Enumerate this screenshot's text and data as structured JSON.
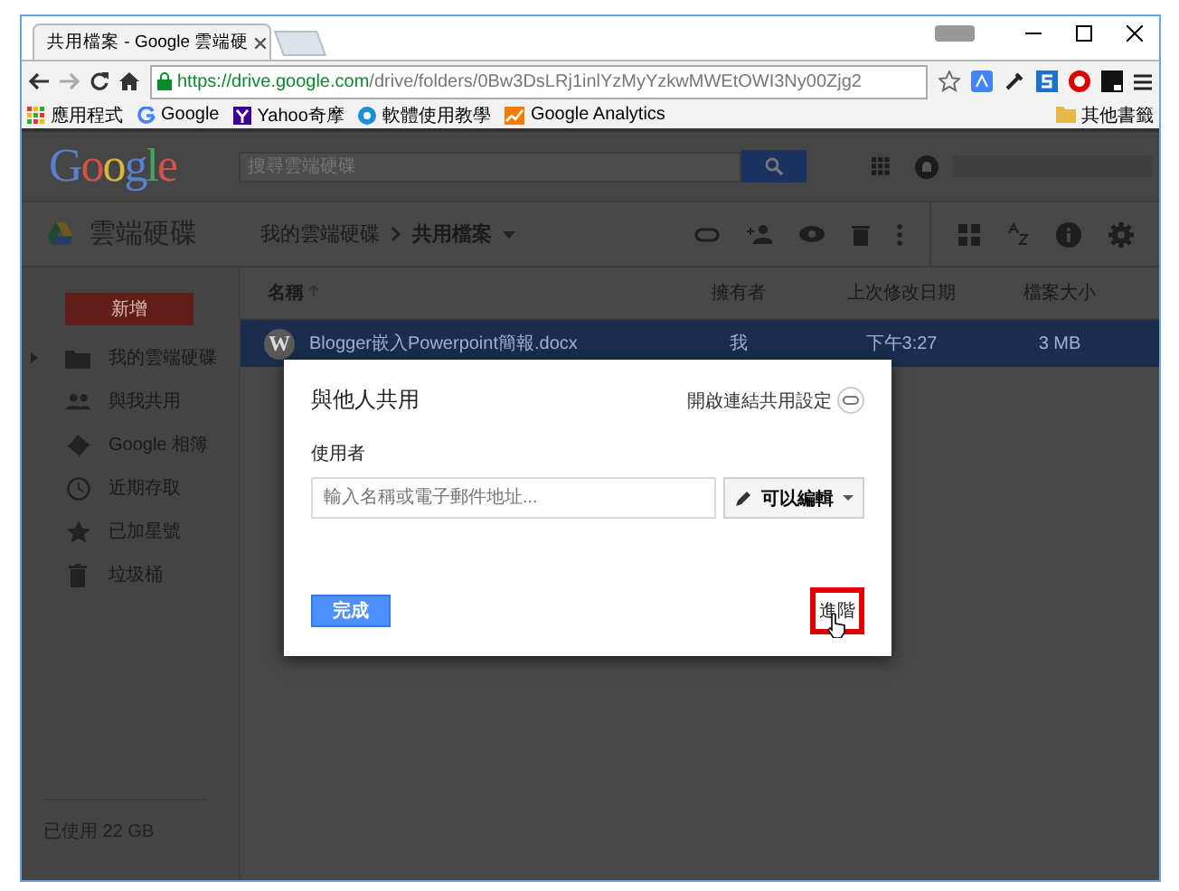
{
  "browser": {
    "tabs": [
      {
        "title": "共用檔案 - Google 雲端硬",
        "selected": true
      }
    ],
    "address": {
      "origin": "https://drive.google.com",
      "path": "/drive/folders/0Bw3DsLRj1inlYzMyYzkwMWEtOWI3Ny00Zjg2"
    },
    "bookmarks": [
      {
        "label": "應用程式",
        "kind": "apps"
      },
      {
        "label": "Google",
        "kind": "google"
      },
      {
        "label": "Yahoo奇摩",
        "kind": "yahoo"
      },
      {
        "label": "軟體使用教學",
        "kind": "tutorial"
      },
      {
        "label": "Google Analytics",
        "kind": "analytics"
      }
    ],
    "other_bookmarks": "其他書籤"
  },
  "drive": {
    "logo": "Google",
    "search": {
      "placeholder": "搜尋雲端硬碟"
    },
    "app_title": "雲端硬碟",
    "breadcrumb": [
      {
        "label": "我的雲端硬碟"
      },
      {
        "label": "共用檔案"
      }
    ],
    "new_button": "新增",
    "sidebar": [
      {
        "label": "我的雲端硬碟",
        "kind": "drive"
      },
      {
        "label": "與我共用",
        "kind": "shared"
      },
      {
        "label": "Google 相簿",
        "kind": "photos"
      },
      {
        "label": "近期存取",
        "kind": "recent"
      },
      {
        "label": "已加星號",
        "kind": "starred"
      },
      {
        "label": "垃圾桶",
        "kind": "trash"
      }
    ],
    "storage": "已使用 22 GB",
    "table": {
      "columns": [
        "名稱",
        "擁有者",
        "上次修改日期",
        "檔案大小"
      ],
      "rows": [
        {
          "name": "Blogger嵌入Powerpoint簡報.docx",
          "owner": "我",
          "modified": "下午3:27",
          "size": "3 MB",
          "icon_letter": "W",
          "selected": true
        }
      ]
    }
  },
  "dialog": {
    "title": "與他人共用",
    "link_settings": "開啟連結共用設定",
    "people_label": "使用者",
    "input": {
      "placeholder": "輸入名稱或電子郵件地址..."
    },
    "permission": "可以編輯",
    "done_button": "完成",
    "advanced_link": "進階",
    "advanced_highlighted": true
  }
}
